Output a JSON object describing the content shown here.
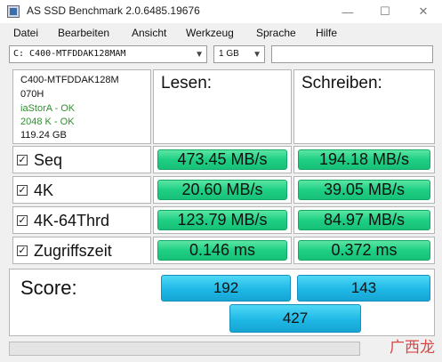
{
  "window": {
    "title": "AS SSD Benchmark 2.0.6485.19676"
  },
  "menu": [
    "Datei",
    "Bearbeiten",
    "Ansicht",
    "Werkzeug",
    "Sprache",
    "Hilfe"
  ],
  "toolbar": {
    "drive_value": "C: C400-MTFDDAK128MAM",
    "size_value": "1 GB",
    "free_field_value": ""
  },
  "drive_info": {
    "model": "C400-MTFDDAK128M",
    "firmware": "070H",
    "driver_status": "iaStorA - OK",
    "alignment_status": "2048 K - OK",
    "capacity": "119.24 GB"
  },
  "headers": {
    "read": "Lesen:",
    "write": "Schreiben:"
  },
  "rows": [
    {
      "label": "Seq",
      "checked": true,
      "read": "473.45 MB/s",
      "write": "194.18 MB/s"
    },
    {
      "label": "4K",
      "checked": true,
      "read": "20.60 MB/s",
      "write": "39.05 MB/s"
    },
    {
      "label": "4K-64Thrd",
      "checked": true,
      "read": "123.79 MB/s",
      "write": "84.97 MB/s"
    },
    {
      "label": "Zugriffszeit",
      "checked": true,
      "read": "0.146 ms",
      "write": "0.372 ms"
    }
  ],
  "score": {
    "label": "Score:",
    "read": "192",
    "write": "143",
    "total": "427"
  },
  "watermark": {
    "text": "广西龙网"
  },
  "colors": {
    "result_green": "#1ecf84",
    "score_blue": "#1fb8e6",
    "ok_green": "#2f8f2f"
  }
}
